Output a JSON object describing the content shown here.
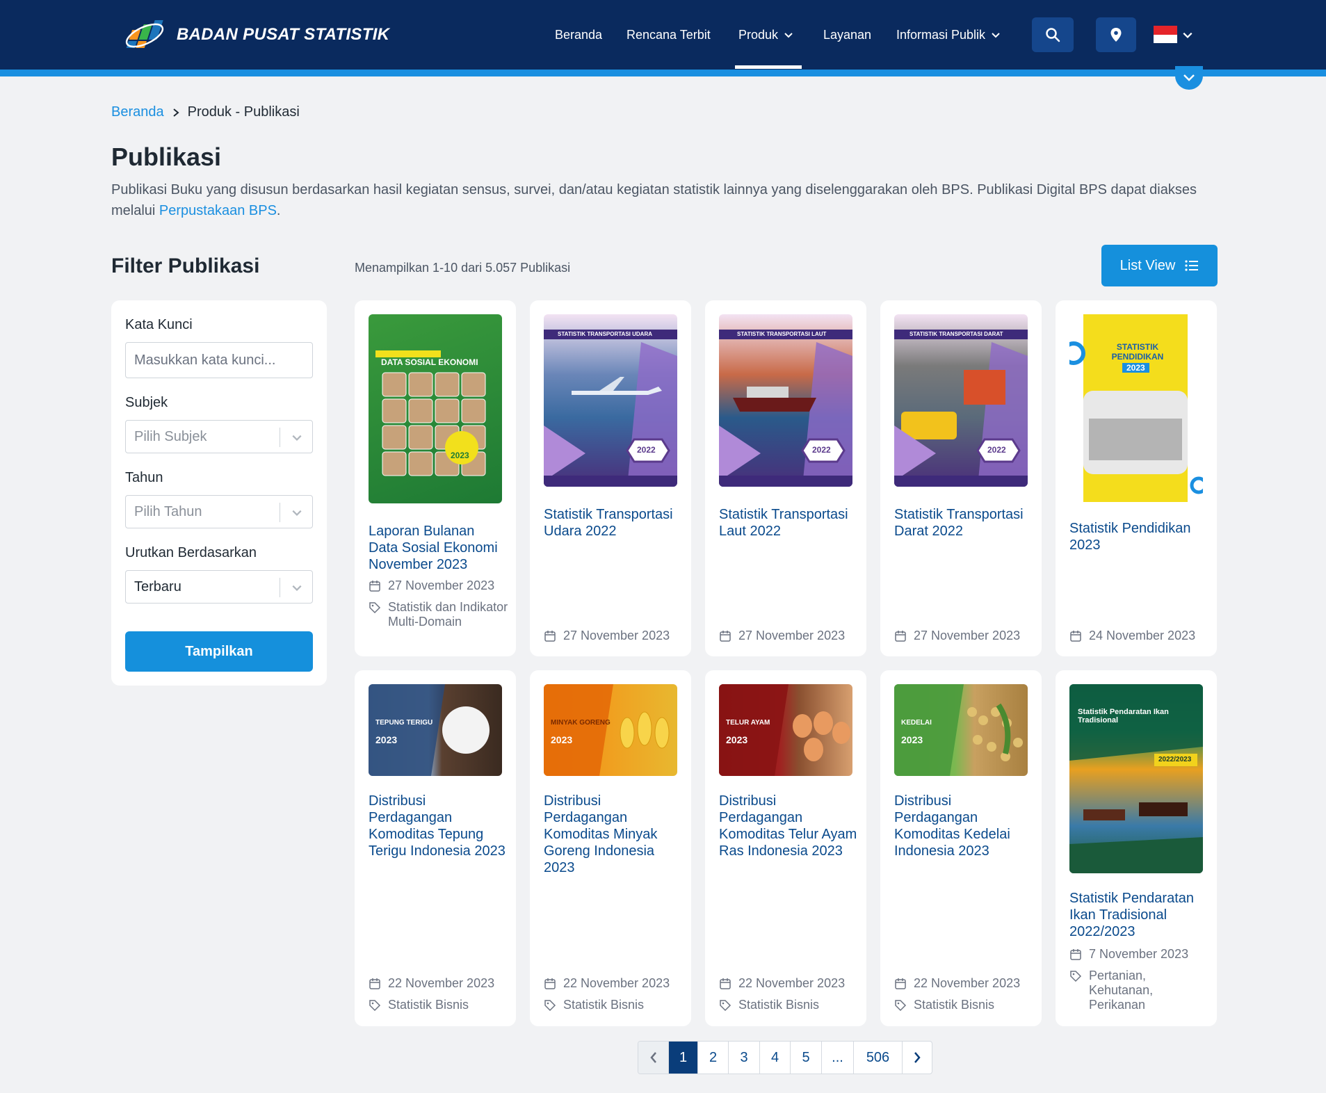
{
  "header": {
    "logo_text": "BADAN PUSAT STATISTIK",
    "nav": [
      {
        "label": "Beranda"
      },
      {
        "label": "Rencana Terbit"
      },
      {
        "label": "Produk"
      },
      {
        "label": "Layanan"
      },
      {
        "label": "Informasi Publik"
      }
    ],
    "active_nav": "Produk",
    "icons": [
      "search-icon",
      "location-pin-icon",
      "indonesia-flag-icon",
      "chevron-down-icon"
    ]
  },
  "breadcrumb": {
    "home": "Beranda",
    "current": "Produk - Publikasi"
  },
  "page": {
    "title": "Publikasi",
    "description": "Publikasi Buku yang disusun berdasarkan hasil kegiatan sensus, survei, dan/atau kegiatan statistik lainnya yang diselenggarakan oleh BPS. Publikasi Digital BPS dapat diakses melalui ",
    "description_link": "Perpustakaan BPS",
    "description_end": "."
  },
  "filter": {
    "title": "Filter Publikasi",
    "keyword_label": "Kata Kunci",
    "keyword_placeholder": "Masukkan kata kunci...",
    "subject_label": "Subjek",
    "subject_placeholder": "Pilih Subjek",
    "year_label": "Tahun",
    "year_placeholder": "Pilih Tahun",
    "sort_label": "Urutkan Berdasarkan",
    "sort_value": "Terbaru",
    "submit_label": "Tampilkan"
  },
  "results": {
    "count_text": "Menampilkan 1-10 dari 5.057 Publikasi",
    "view_button": "List View"
  },
  "publications": [
    {
      "title": "Laporan Bulanan Data Sosial Ekonomi November 2023",
      "date": "27 November 2023",
      "category": "Statistik dan Indikator Multi-Domain",
      "cover_text": "DATA SOSIAL EKONOMI",
      "cover_year": "2023",
      "accent": "#2e8b3a"
    },
    {
      "title": "Statistik Transportasi Udara 2022",
      "date": "27 November 2023",
      "category": "",
      "cover_text": "STATISTIK TRANSPORTASI UDARA",
      "cover_year": "2022",
      "accent": "#5b3a8c"
    },
    {
      "title": "Statistik Transportasi Laut 2022",
      "date": "27 November 2023",
      "category": "",
      "cover_text": "STATISTIK TRANSPORTASI LAUT",
      "cover_year": "2022",
      "accent": "#5b3a8c"
    },
    {
      "title": "Statistik Transportasi Darat 2022",
      "date": "27 November 2023",
      "category": "",
      "cover_text": "STATISTIK TRANSPORTASI DARAT",
      "cover_year": "2022",
      "accent": "#5b3a8c"
    },
    {
      "title": "Statistik Pendidikan 2023",
      "date": "24 November 2023",
      "category": "",
      "cover_text": "STATISTIK PENDIDIKAN",
      "cover_year": "2023",
      "accent": "#f2d21c"
    },
    {
      "title": "Distribusi Perdagangan Komoditas Tepung Terigu Indonesia 2023",
      "date": "22 November 2023",
      "category": "Statistik Bisnis",
      "cover_text": "TEPUNG TERIGU",
      "cover_year": "2023",
      "accent": "#274a7a"
    },
    {
      "title": "Distribusi Perdagangan Komoditas Minyak Goreng Indonesia 2023",
      "date": "22 November 2023",
      "category": "Statistik Bisnis",
      "cover_text": "MINYAK GORENG",
      "cover_year": "2023",
      "accent": "#f08a10"
    },
    {
      "title": "Distribusi Perdagangan Komoditas Telur Ayam Ras Indonesia 2023",
      "date": "22 November 2023",
      "category": "Statistik Bisnis",
      "cover_text": "TELUR AYAM",
      "cover_year": "2023",
      "accent": "#8c1a1a"
    },
    {
      "title": "Distribusi Perdagangan Komoditas Kedelai Indonesia 2023",
      "date": "22 November 2023",
      "category": "Statistik Bisnis",
      "cover_text": "KEDELAI",
      "cover_year": "2023",
      "accent": "#5aa84a"
    },
    {
      "title": "Statistik Pendaratan Ikan Tradisional 2022/2023",
      "date": "7 November 2023",
      "category": "Pertanian, Kehutanan, Perikanan",
      "cover_text": "Statistik Pendaratan Ikan Tradisional",
      "cover_year": "2022/2023",
      "accent": "#0f7a5a"
    }
  ],
  "pagination": {
    "pages": [
      "1",
      "2",
      "3",
      "4",
      "5",
      "...",
      "506"
    ],
    "current": "1"
  }
}
